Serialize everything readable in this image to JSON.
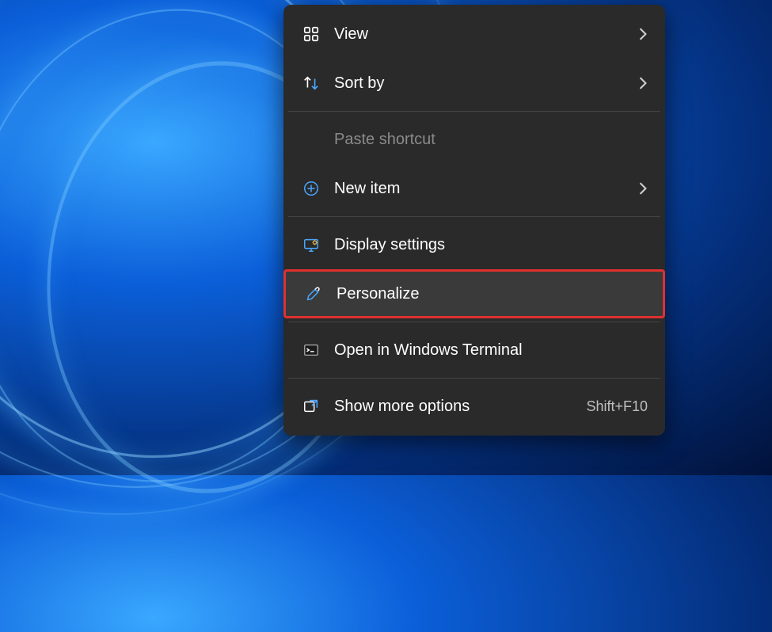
{
  "menu": {
    "items": [
      {
        "label": "View",
        "has_submenu": true
      },
      {
        "label": "Sort by",
        "has_submenu": true
      },
      {
        "label": "Paste shortcut",
        "disabled": true
      },
      {
        "label": "New item",
        "has_submenu": true
      },
      {
        "label": "Display settings"
      },
      {
        "label": "Personalize",
        "highlighted": true
      },
      {
        "label": "Open in Windows Terminal"
      },
      {
        "label": "Show more options",
        "shortcut": "Shift+F10"
      }
    ]
  }
}
